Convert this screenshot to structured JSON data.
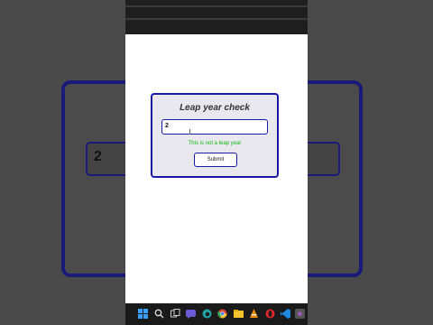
{
  "background": {
    "input_value": "2"
  },
  "app": {
    "title": "Leap year check",
    "input_value": "2",
    "result_text": "This is not a leap year",
    "submit_label": "Submit",
    "result_color": "#14b814",
    "accent_color": "#1a1aa8"
  },
  "taskbar": {
    "icons": [
      "windows-start-icon",
      "search-icon",
      "task-view-icon",
      "chat-icon",
      "edge-browser-icon",
      "chrome-browser-icon",
      "file-explorer-icon",
      "vlc-icon",
      "vscode-icon",
      "opera-browser-icon",
      "app-icon"
    ]
  }
}
